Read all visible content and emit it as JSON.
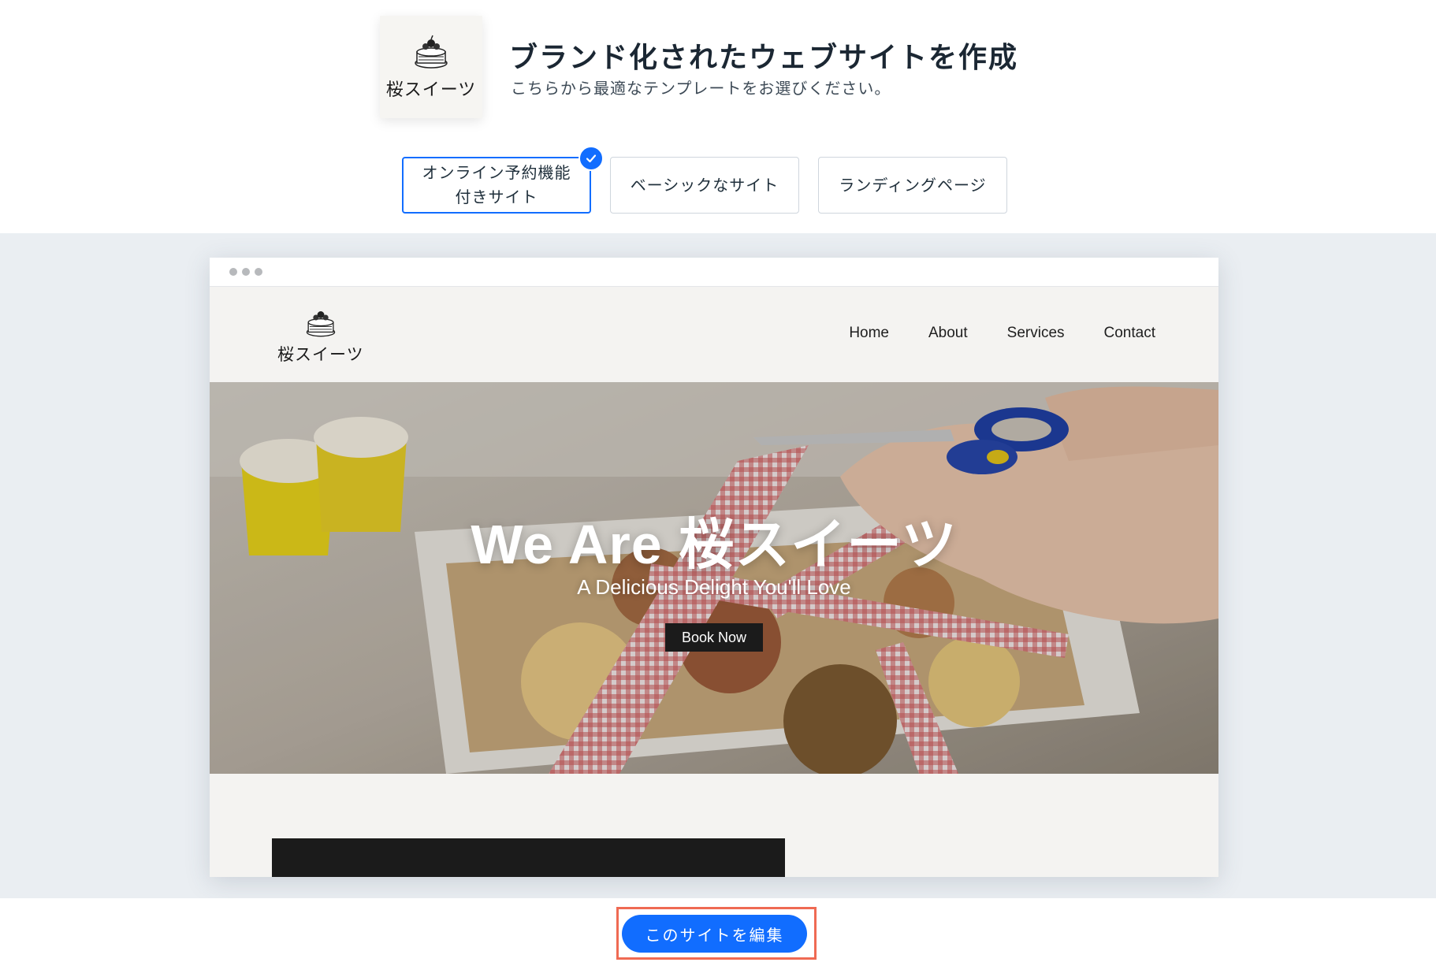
{
  "header": {
    "brand_name": "桜スイーツ",
    "title": "ブランド化されたウェブサイトを作成",
    "subtitle": "こちらから最適なテンプレートをお選びください。"
  },
  "template_tabs": [
    {
      "line1": "オンライン予約機能",
      "line2": "付きサイト",
      "selected": true
    },
    {
      "label": "ベーシックなサイト",
      "selected": false
    },
    {
      "label": "ランディングページ",
      "selected": false
    }
  ],
  "preview": {
    "site_logo_name": "桜スイーツ",
    "nav": [
      "Home",
      "About",
      "Services",
      "Contact"
    ],
    "hero_title": "We Are 桜スイーツ",
    "hero_subtitle": "A Delicious Delight You'll Love",
    "hero_button": "Book Now"
  },
  "footer": {
    "edit_button": "このサイトを編集"
  },
  "colors": {
    "accent": "#116dff",
    "highlight_frame": "#ef6a53",
    "preview_bg": "#eaeef2"
  },
  "icons": [
    "cake-logo-icon",
    "checkmark-icon",
    "window-dots-icon"
  ]
}
